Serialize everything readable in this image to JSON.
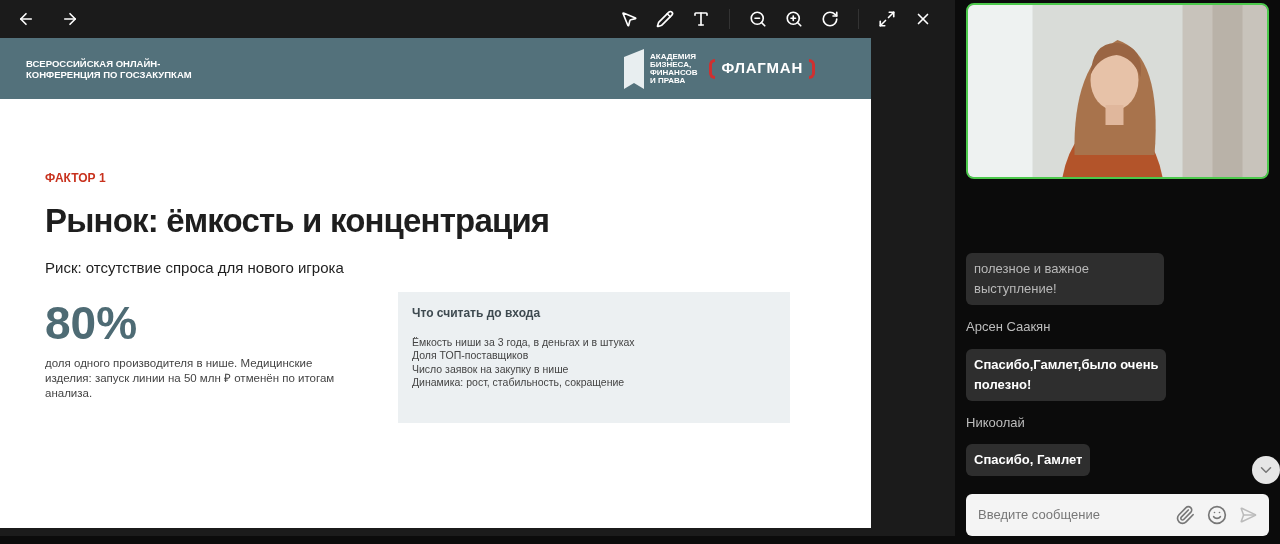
{
  "slide": {
    "header_title": "ВСЕРОССИЙСКАЯ ОНЛАЙН-\nКОНФЕРЕНЦИЯ ПО ГОСЗАКУПКАМ",
    "logo_academy": "АКАДЕМИЯ\nБИЗНЕСА,\nФИНАНСОВ\nИ ПРАВА",
    "logo_flagman": "ФЛАГМАН",
    "kicker": "ФАКТОР 1",
    "title": "Рынок: ёмкость и концентрация",
    "subtitle": "Риск: отсутствие спроса для нового игрока",
    "stat": "80%",
    "stat_caption": "доля одного производителя в нише. Медицинские изделия: запуск линии на 50 млн ₽ отменён по итогам анализа.",
    "box_title": "Что считать до входа",
    "box_items": [
      "Ёмкость ниши за 3 года, в деньгах и в штуках",
      "Доля ТОП-поставщиков",
      "Число заявок на закупку в нише",
      "Динамика: рост, стабильность, сокращение"
    ]
  },
  "chat": {
    "messages": [
      {
        "text": "полезное и важное\nвыступление!",
        "faded": true
      },
      {
        "author": "Арсен Саакян",
        "text": "Спасибо,Гамлет,было очень\nполезно!",
        "faded": false
      },
      {
        "author": "Никоолай",
        "text": "Спасибо, Гамлет",
        "faded": false
      }
    ],
    "input": {
      "placeholder": "Введите сообщение"
    }
  }
}
